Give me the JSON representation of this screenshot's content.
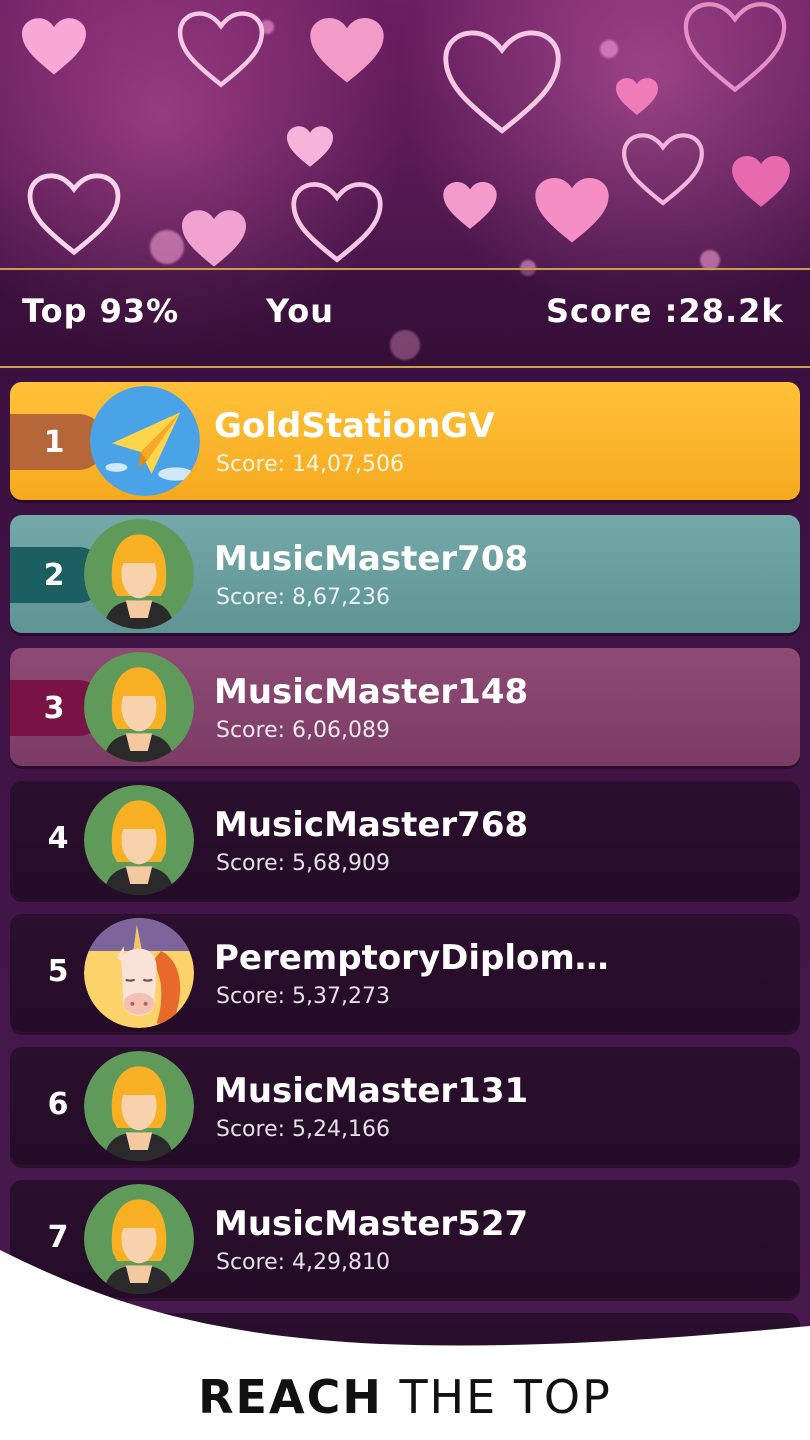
{
  "header": {
    "top_percent": "Top 93%",
    "you_label": "You",
    "score_label": "Score :28.2k"
  },
  "leaderboard": [
    {
      "rank": "1",
      "name": "GoldStationGV",
      "score": "Score: 14,07,506",
      "avatar": "paper-plane-icon",
      "style": "gold"
    },
    {
      "rank": "2",
      "name": "MusicMaster708",
      "score": "Score: 8,67,236",
      "avatar": "female-avatar",
      "style": "teal"
    },
    {
      "rank": "3",
      "name": "MusicMaster148",
      "score": "Score: 6,06,089",
      "avatar": "female-avatar",
      "style": "rose"
    },
    {
      "rank": "4",
      "name": "MusicMaster768",
      "score": "Score: 5,68,909",
      "avatar": "female-avatar",
      "style": "dark"
    },
    {
      "rank": "5",
      "name": "PeremptoryDiplom…",
      "score": "Score: 5,37,273",
      "avatar": "unicorn-avatar",
      "style": "dark"
    },
    {
      "rank": "6",
      "name": "MusicMaster131",
      "score": "Score: 5,24,166",
      "avatar": "female-avatar",
      "style": "dark"
    },
    {
      "rank": "7",
      "name": "MusicMaster527",
      "score": "Score: 4,29,810",
      "avatar": "female-avatar",
      "style": "dark"
    }
  ],
  "caption": {
    "bold": "REACH",
    "rest": "THE TOP"
  },
  "colors": {
    "gold": "#f6a91f",
    "teal": "#5f9495",
    "rose": "#7a3c65",
    "dark": "#240c27",
    "rank_tab_gold": "#b5673a",
    "rank_tab_teal": "#1b5f63",
    "rank_tab_rose": "#7a1345"
  }
}
